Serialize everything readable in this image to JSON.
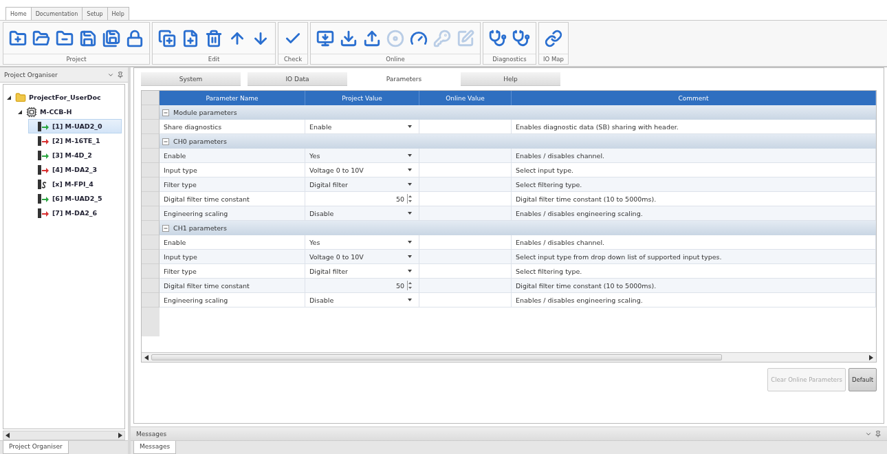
{
  "ribbon_tabs": [
    {
      "label": "Home",
      "selected": true
    },
    {
      "label": "Documentation",
      "selected": false
    },
    {
      "label": "Setup",
      "selected": false
    },
    {
      "label": "Help",
      "selected": false
    }
  ],
  "ribbon_groups": [
    {
      "label": "Project",
      "buttons": [
        {
          "kind": "new-folder",
          "disabled": false
        },
        {
          "kind": "open-folder",
          "disabled": false
        },
        {
          "kind": "close-folder",
          "disabled": false
        },
        {
          "kind": "save",
          "disabled": false
        },
        {
          "kind": "save-as",
          "disabled": false
        },
        {
          "kind": "lock",
          "disabled": false
        }
      ]
    },
    {
      "label": "Edit",
      "buttons": [
        {
          "kind": "add-module",
          "disabled": false
        },
        {
          "kind": "add-item",
          "disabled": false
        },
        {
          "kind": "delete",
          "disabled": false
        },
        {
          "kind": "move-up",
          "disabled": false
        },
        {
          "kind": "move-down",
          "disabled": false
        }
      ]
    },
    {
      "label": "Check",
      "buttons": [
        {
          "kind": "check",
          "disabled": false
        }
      ]
    },
    {
      "label": "Online",
      "buttons": [
        {
          "kind": "connect",
          "disabled": false
        },
        {
          "kind": "download",
          "disabled": false
        },
        {
          "kind": "upload",
          "disabled": false
        },
        {
          "kind": "disc",
          "disabled": true
        },
        {
          "kind": "gauge",
          "disabled": false
        },
        {
          "kind": "probe",
          "disabled": true
        },
        {
          "kind": "edit",
          "disabled": true
        }
      ]
    },
    {
      "label": "Diagnostics",
      "buttons": [
        {
          "kind": "stethoscope",
          "disabled": false
        },
        {
          "kind": "stethoscope",
          "disabled": false
        }
      ]
    },
    {
      "label": "IO Map",
      "buttons": [
        {
          "kind": "link",
          "disabled": false
        }
      ]
    }
  ],
  "project_organiser": {
    "title": "Project Organiser",
    "tree": [
      {
        "label": "ProjectFor_UserDoc",
        "kind": "folder",
        "expanded": true,
        "selected": false,
        "children": [
          {
            "label": "M-CCB-H",
            "kind": "head",
            "expanded": true,
            "selected": false,
            "children": [
              {
                "label": "[1] M-UAD2_0",
                "kind": "input",
                "selected": true
              },
              {
                "label": "[2] M-16TE_1",
                "kind": "output",
                "selected": false
              },
              {
                "label": "[3] M-4D_2",
                "kind": "input",
                "selected": false
              },
              {
                "label": "[4] M-DA2_3",
                "kind": "output",
                "selected": false
              },
              {
                "label": "[x] M-FPI_4",
                "kind": "special",
                "selected": false
              },
              {
                "label": "[6] M-UAD2_5",
                "kind": "input",
                "selected": false
              },
              {
                "label": "[7] M-DA2_6",
                "kind": "output",
                "selected": false
              }
            ]
          }
        ]
      }
    ],
    "bottom_tab": "Project Organiser"
  },
  "editor_tabs": [
    {
      "label": "System",
      "selected": false
    },
    {
      "label": "IO Data",
      "selected": false
    },
    {
      "label": "Parameters",
      "selected": true
    },
    {
      "label": "Help",
      "selected": false
    }
  ],
  "table": {
    "columns": [
      "Parameter Name",
      "Project Value",
      "Online Value",
      "Comment"
    ],
    "groups": [
      {
        "title": "Module parameters",
        "expanded": true,
        "rows": [
          {
            "name": "Share diagnostics",
            "value": "Enable",
            "kind": "dropdown",
            "comment": "Enables diagnostic data (SB) sharing with header."
          }
        ]
      },
      {
        "title": "CH0 parameters",
        "expanded": true,
        "rows": [
          {
            "name": "Enable",
            "value": "Yes",
            "kind": "dropdown",
            "comment": "Enables / disables channel."
          },
          {
            "name": "Input type",
            "value": "Voltage 0 to 10V",
            "kind": "dropdown",
            "comment": "Select input type."
          },
          {
            "name": "Filter type",
            "value": "Digital filter",
            "kind": "dropdown",
            "comment": "Select filtering type."
          },
          {
            "name": "Digital filter time constant",
            "value": "50",
            "kind": "spinner",
            "comment": "Digital filter time constant (10 to 5000ms)."
          },
          {
            "name": "Engineering scaling",
            "value": "Disable",
            "kind": "dropdown",
            "comment": "Enables / disables engineering scaling."
          }
        ]
      },
      {
        "title": "CH1 parameters",
        "expanded": true,
        "rows": [
          {
            "name": "Enable",
            "value": "Yes",
            "kind": "dropdown",
            "comment": "Enables / disables channel."
          },
          {
            "name": "Input type",
            "value": "Voltage 0 to 10V",
            "kind": "dropdown",
            "comment": "Select input type from drop down list of supported input types."
          },
          {
            "name": "Filter type",
            "value": "Digital filter",
            "kind": "dropdown",
            "comment": "Select filtering type."
          },
          {
            "name": "Digital filter time constant",
            "value": "50",
            "kind": "spinner",
            "comment": "Digital filter time constant (10 to 5000ms)."
          },
          {
            "name": "Engineering scaling",
            "value": "Disable",
            "kind": "dropdown",
            "comment": "Enables / disables engineering scaling."
          }
        ]
      }
    ]
  },
  "buttons": [
    {
      "label": "Clear Online Parameters",
      "disabled": true
    },
    {
      "label": "Default",
      "disabled": false
    }
  ],
  "messages": {
    "title": "Messages",
    "tab": "Messages"
  }
}
